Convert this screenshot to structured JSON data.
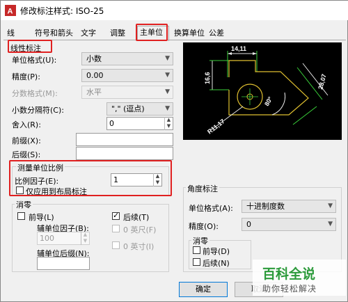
{
  "window": {
    "title": "修改标注样式: ISO-25"
  },
  "tabs": [
    "线",
    "符号和箭头",
    "文字",
    "调整",
    "主单位",
    "换算单位",
    "公差"
  ],
  "linear": {
    "group_title": "线性标注",
    "unit_format_label": "单位格式(U):",
    "unit_format_value": "小数",
    "precision_label": "精度(P):",
    "precision_value": "0.00",
    "fraction_label": "分数格式(M):",
    "fraction_value": "水平",
    "decimal_sep_label": "小数分隔符(C):",
    "decimal_sep_value": "\",\" (逗点)",
    "round_label": "舍入(R):",
    "round_value": "0",
    "prefix_label": "前缀(X):",
    "prefix_value": "",
    "suffix_label": "后缀(S):",
    "suffix_value": ""
  },
  "scale": {
    "title": "测量单位比例",
    "factor_label": "比例因子(E):",
    "factor_value": "1",
    "layout_only_label": "仅应用到布局标注"
  },
  "zero_left": {
    "title": "消零",
    "leading_label": "前导(L)",
    "sub_factor_label": "辅单位因子(B):",
    "sub_factor_value": "100",
    "sub_suffix_label": "辅单位后缀(N):",
    "sub_suffix_value": "",
    "trailing_label": "后续(T)",
    "feet_label": "0 英尺(F)",
    "inch_label": "0 英寸(I)"
  },
  "angular": {
    "title": "角度标注",
    "unit_format_label": "单位格式(A):",
    "unit_format_value": "十进制度数",
    "precision_label": "精度(O):",
    "precision_value": "0",
    "zero_title": "消零",
    "leading_label": "前导(D)",
    "trailing_label": "后续(N)"
  },
  "preview": {
    "dim_top": "14,11",
    "dim_left": "16,6",
    "dim_right": "28,07",
    "dim_angle": "80°",
    "dim_radius": "R11,17"
  },
  "buttons": {
    "ok": "确定",
    "cancel": "取消"
  },
  "watermark": {
    "title": "百科全说",
    "subtitle": "助你轻松解决"
  },
  "colors": {
    "highlight_red": "#e02020",
    "preview_bg": "#000000",
    "watermark_green": "#2b9a3a"
  }
}
